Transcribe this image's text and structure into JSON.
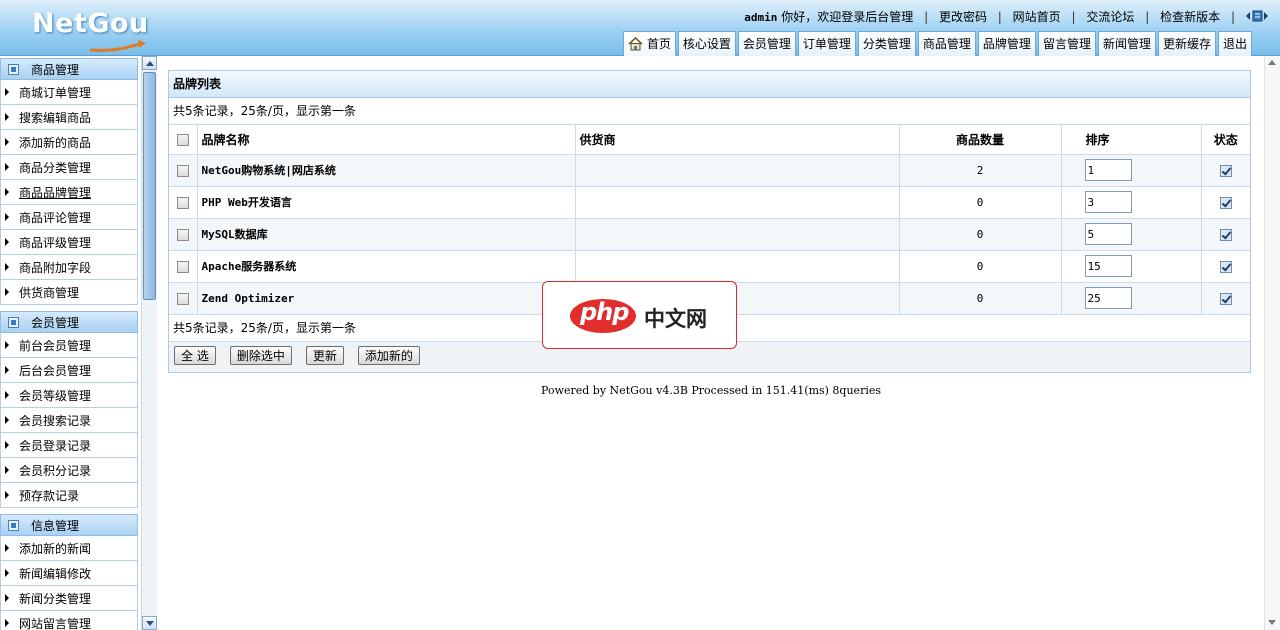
{
  "header": {
    "logo_text": "NetGou",
    "user": "admin",
    "greeting": "你好，欢迎登录后台管理",
    "links": [
      "更改密码",
      "网站首页",
      "交流论坛",
      "检查新版本"
    ],
    "tabs": [
      "首页",
      "核心设置",
      "会员管理",
      "订单管理",
      "分类管理",
      "商品管理",
      "品牌管理",
      "留言管理",
      "新闻管理",
      "更新缓存",
      "退出"
    ]
  },
  "sidebar": {
    "groups": [
      {
        "title": "商品管理",
        "items": [
          "商城订单管理",
          "搜索编辑商品",
          "添加新的商品",
          "商品分类管理",
          "商品品牌管理",
          "商品评论管理",
          "商品评级管理",
          "商品附加字段",
          "供货商管理"
        ]
      },
      {
        "title": "会员管理",
        "items": [
          "前台会员管理",
          "后台会员管理",
          "会员等级管理",
          "会员搜索记录",
          "会员登录记录",
          "会员积分记录",
          "预存款记录"
        ]
      },
      {
        "title": "信息管理",
        "items": [
          "添加新的新闻",
          "新闻编辑修改",
          "新闻分类管理",
          "网站留言管理"
        ]
      }
    ]
  },
  "main": {
    "panel_title": "品牌列表",
    "summary": "共5条记录，25条/页，显示第一条",
    "columns": {
      "name": "品牌名称",
      "supplier": "供货商",
      "qty": "商品数量",
      "sort": "排序",
      "state": "状态"
    },
    "rows": [
      {
        "name": "NetGou购物系统|网店系统",
        "supplier": "",
        "qty": "2",
        "sort": "1",
        "state": true
      },
      {
        "name": "PHP Web开发语言",
        "supplier": "",
        "qty": "0",
        "sort": "3",
        "state": true
      },
      {
        "name": "MySQL数据库",
        "supplier": "",
        "qty": "0",
        "sort": "5",
        "state": true
      },
      {
        "name": "Apache服务器系统",
        "supplier": "",
        "qty": "0",
        "sort": "15",
        "state": true
      },
      {
        "name": "Zend Optimizer",
        "supplier": "",
        "qty": "0",
        "sort": "25",
        "state": true
      }
    ],
    "footer_summary": "共5条记录，25条/页，显示第一条",
    "buttons": {
      "select_all": "全 选",
      "delete_selected": "删除选中",
      "update": "更新",
      "add_new": "添加新的"
    },
    "powered": "Powered by NetGou v4.3B Processed in 151.41(ms) 8queries"
  },
  "watermark": {
    "logo": "php",
    "text": "中文网"
  },
  "colors": {
    "header_top": "#dff0fb",
    "header_bottom": "#79bde9",
    "border": "#a9cbe6",
    "watermark_red": "#e22d2d"
  },
  "icons": {
    "home_tab": "home-icon",
    "nav_arrows": "chevron-left-right-icon",
    "group": "folder-square-icon",
    "item": "triangle-right-icon",
    "checkbox": "checkbox-icon"
  }
}
